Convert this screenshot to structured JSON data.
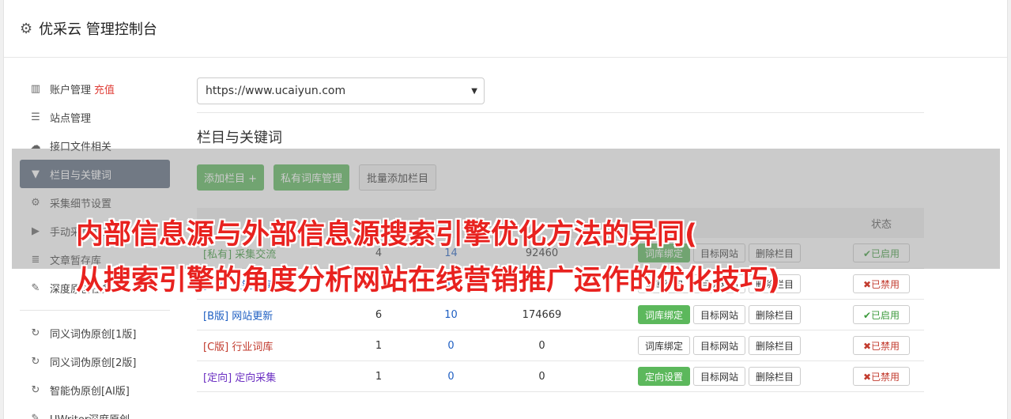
{
  "header": {
    "title": "优采云 管理控制台"
  },
  "sidebar": {
    "items": [
      {
        "label": "账户管理",
        "extra": "充值",
        "icon": "bar-chart-icon"
      },
      {
        "label": "站点管理",
        "icon": "server-icon"
      },
      {
        "label": "接口文件相关",
        "icon": "cloud-upload-icon"
      },
      {
        "label": "栏目与关键词",
        "icon": "filter-icon"
      },
      {
        "label": "采集细节设置",
        "icon": "cogs-icon"
      },
      {
        "label": "手动采集发布",
        "icon": "play-circle-icon"
      },
      {
        "label": "文章暂存库",
        "icon": "database-icon"
      },
      {
        "label": "深度原创任务",
        "icon": "edit-icon"
      }
    ],
    "items2": [
      {
        "label": "同义词伪原创[1版]",
        "icon": "refresh-icon"
      },
      {
        "label": "同义词伪原创[2版]",
        "icon": "refresh-icon"
      },
      {
        "label": "智能伪原创[AI版]",
        "icon": "refresh-icon"
      },
      {
        "label": "UWriter深度原创",
        "icon": "edit-icon"
      }
    ]
  },
  "main": {
    "site_select": "https://www.ucaiyun.com",
    "section_title": "栏目与关键词",
    "buttons": {
      "add_column": "添加栏目 +",
      "private_lib": "私有词库管理",
      "batch_add": "批量添加栏目"
    },
    "table": {
      "headers": {
        "name": "",
        "col2": "",
        "col3": "",
        "col4": "",
        "actions": "",
        "status": "状态"
      },
      "rows": [
        {
          "tag": "[私有]",
          "name": "采集交流",
          "n1": "4",
          "n2": "14",
          "n3": "92460",
          "b1": "词库绑定",
          "b2": "目标网站",
          "b3": "删除栏目",
          "state": "✔已启用",
          "tagClass": "tag-green",
          "b1g": true,
          "on": true
        },
        {
          "tag": "[A版]",
          "name": "关键词库",
          "n1": "1",
          "n2": "0",
          "n3": "0",
          "b1": "词库绑定",
          "b2": "目标网站",
          "b3": "删除栏目",
          "state": "✖已禁用",
          "tagClass": "tag-blue",
          "b1g": false,
          "on": false
        },
        {
          "tag": "[B版]",
          "name": "网站更新",
          "n1": "6",
          "n2": "10",
          "n3": "174669",
          "b1": "词库绑定",
          "b2": "目标网站",
          "b3": "删除栏目",
          "state": "✔已启用",
          "tagClass": "tag-blue",
          "b1g": true,
          "on": true
        },
        {
          "tag": "[C版]",
          "name": "行业词库",
          "n1": "1",
          "n2": "0",
          "n3": "0",
          "b1": "词库绑定",
          "b2": "目标网站",
          "b3": "删除栏目",
          "state": "✖已禁用",
          "tagClass": "tag-red",
          "b1g": false,
          "on": false
        },
        {
          "tag": "[定向]",
          "name": "定向采集",
          "n1": "1",
          "n2": "0",
          "n3": "0",
          "b1": "定向设置",
          "b2": "目标网站",
          "b3": "删除栏目",
          "state": "✖已禁用",
          "tagClass": "tag-purple",
          "b1g": true,
          "on": false
        }
      ]
    }
  },
  "overlay": {
    "line1": "内部信息源与外部信息源搜索引擎优化方法的异同(",
    "line2": "从搜索引擎的角度分析网站在线营销推广运作的优化技巧)"
  }
}
